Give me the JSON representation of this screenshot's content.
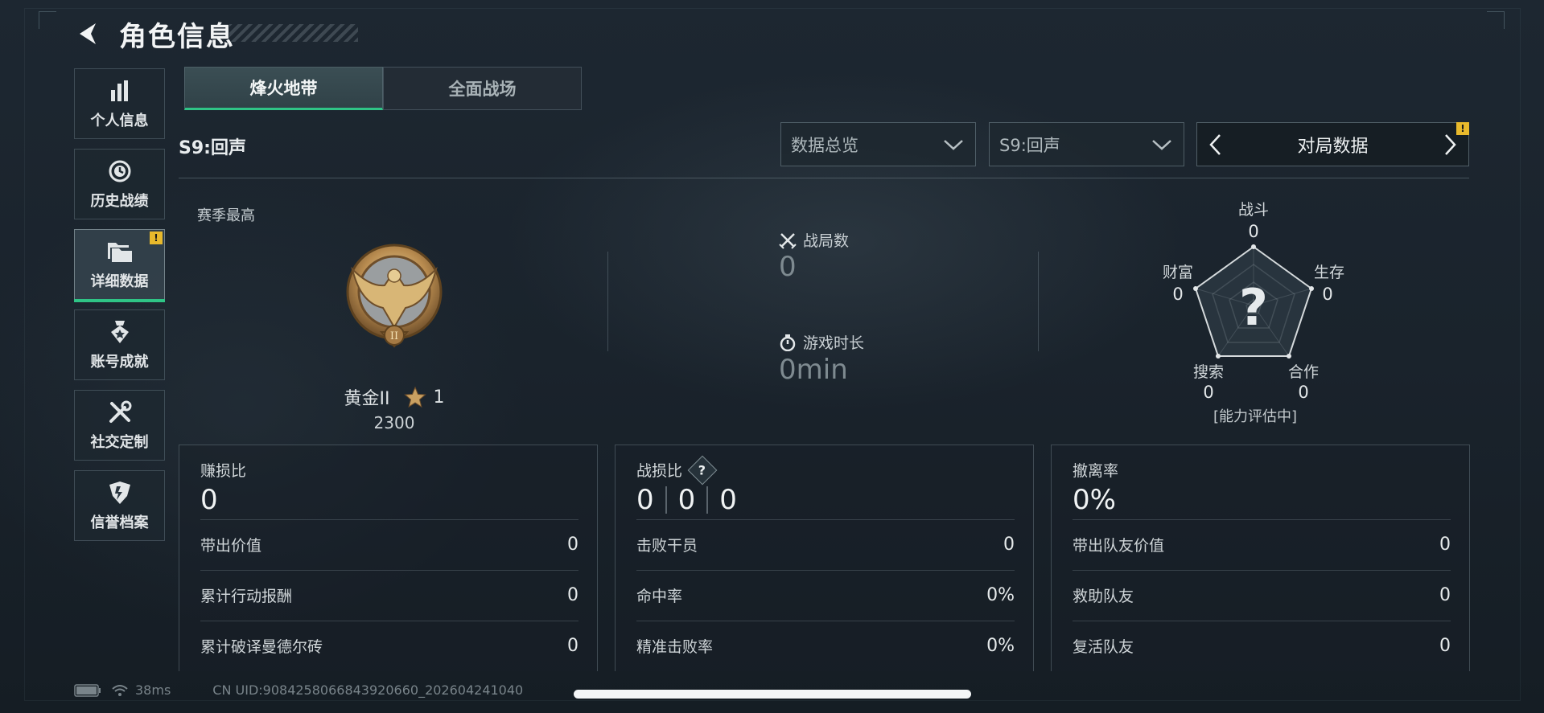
{
  "header": {
    "title": "角色信息"
  },
  "sidebar": {
    "items": [
      {
        "label": "个人信息",
        "icon": "bar-chart-icon"
      },
      {
        "label": "历史战绩",
        "icon": "clock-history-icon"
      },
      {
        "label": "详细数据",
        "icon": "folders-icon",
        "active": true,
        "badge": "!"
      },
      {
        "label": "账号成就",
        "icon": "medal-icon"
      },
      {
        "label": "社交定制",
        "icon": "tools-icon"
      },
      {
        "label": "信誉档案",
        "icon": "shield-badge-icon"
      }
    ]
  },
  "tabs": [
    {
      "label": "烽火地带",
      "active": true
    },
    {
      "label": "全面战场",
      "active": false
    }
  ],
  "season": {
    "label": "S9:回声"
  },
  "filters": {
    "overview": "数据总览",
    "season": "S9:回声",
    "pager_label": "对局数据",
    "pager_badge": "!"
  },
  "season_best": {
    "label": "赛季最高",
    "rank": "黄金II",
    "stars": "1",
    "points": "2300",
    "emblem_numeral": "II"
  },
  "match_stats": {
    "matches_label": "战局数",
    "matches_value": "0",
    "playtime_label": "游戏时长",
    "playtime_value": "0min"
  },
  "radar": {
    "center_glyph": "?",
    "status": "[能力评估中]",
    "axes": [
      {
        "label": "战斗",
        "value": "0"
      },
      {
        "label": "生存",
        "value": "0"
      },
      {
        "label": "合作",
        "value": "0"
      },
      {
        "label": "搜索",
        "value": "0"
      },
      {
        "label": "财富",
        "value": "0"
      }
    ]
  },
  "panels": [
    {
      "head_label": "赚损比",
      "head_value": "0",
      "rows": [
        {
          "label": "带出价值",
          "value": "0"
        },
        {
          "label": "累计行动报酬",
          "value": "0"
        },
        {
          "label": "累计破译曼德尔砖",
          "value": "0"
        }
      ]
    },
    {
      "head_label": "战损比",
      "help": "?",
      "head_values": [
        "0",
        "0",
        "0"
      ],
      "rows": [
        {
          "label": "击败干员",
          "value": "0"
        },
        {
          "label": "命中率",
          "value": "0%"
        },
        {
          "label": "精准击败率",
          "value": "0%"
        }
      ]
    },
    {
      "head_label": "撤离率",
      "head_value": "0%",
      "rows": [
        {
          "label": "带出队友价值",
          "value": "0"
        },
        {
          "label": "救助队友",
          "value": "0"
        },
        {
          "label": "复活队友",
          "value": "0"
        }
      ]
    }
  ],
  "footer": {
    "ping": "38ms",
    "uid": "CN UID:9084258066843920660_202604241040"
  },
  "colors": {
    "accent": "#2fc486",
    "warning": "#e8b92c",
    "gold": "#c9a061"
  }
}
